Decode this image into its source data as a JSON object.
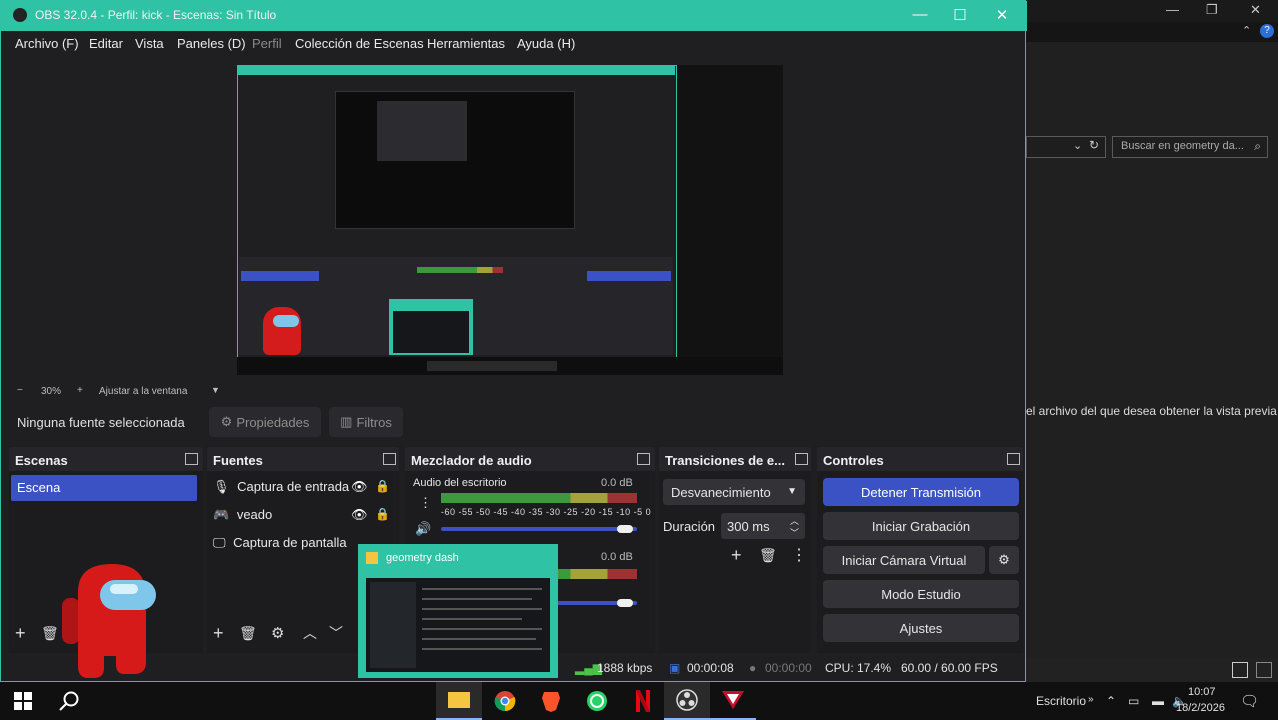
{
  "obs": {
    "title": "OBS 32.0.4 - Perfil: kick - Escenas: Sin Título",
    "menu": [
      {
        "label": "Archivo (F)"
      },
      {
        "label": "Editar"
      },
      {
        "label": "Vista"
      },
      {
        "label": "Paneles (D)"
      },
      {
        "label": "Perfil"
      },
      {
        "label": "Colección de Escenas"
      },
      {
        "label": "Herramientas"
      },
      {
        "label": "Ayuda (H)"
      }
    ],
    "zoom": {
      "minus": "−",
      "value": "30%",
      "plus": "+",
      "fit": "Ajustar a la ventana"
    },
    "source_toolbar": {
      "no_source": "Ninguna fuente seleccionada",
      "properties": "Propiedades",
      "filters": "Filtros"
    },
    "scenes": {
      "header": "Escenas",
      "items": [
        "Escena"
      ]
    },
    "sources": {
      "header": "Fuentes",
      "items": [
        {
          "label": "Captura de entrada",
          "icon": "microphone-icon"
        },
        {
          "label": "veado",
          "icon": "gamepad-icon"
        },
        {
          "label": "Captura de pantalla",
          "icon": "monitor-icon"
        }
      ]
    },
    "mixer": {
      "header": "Mezclador de audio",
      "channels": [
        {
          "name": "Audio del escritorio",
          "db": "0.0 dB"
        },
        {
          "name": "",
          "db": "0.0 dB"
        }
      ],
      "ticks": "-60 -55 -50 -45 -40 -35 -30 -25 -20 -15 -10 -5 0"
    },
    "transitions": {
      "header": "Transiciones de e...",
      "selected": "Desvanecimiento",
      "duration_label": "Duración",
      "duration_value": "300 ms"
    },
    "controls": {
      "header": "Controles",
      "stop_stream": "Detener Transmisión",
      "start_record": "Iniciar Grabación",
      "start_vcam": "Iniciar Cámara Virtual",
      "studio_mode": "Modo Estudio",
      "settings": "Ajustes"
    },
    "status": {
      "kbps": "1888 kbps",
      "stream_time": "00:00:08",
      "rec_time": "00:00:00",
      "cpu": "CPU: 17.4%",
      "fps": "60.00 / 60.00 FPS"
    },
    "accent": "#2fc2a4",
    "selected_color": "#3b52c4"
  },
  "background_window": {
    "search_placeholder": "Buscar en geometry da...",
    "preview_message": "el archivo del que desea obtener la vista previa."
  },
  "thumbnail": {
    "title": "geometry dash"
  },
  "taskbar": {
    "desktop_label": "Escritorio",
    "time": "10:07",
    "date": "18/2/2026"
  }
}
